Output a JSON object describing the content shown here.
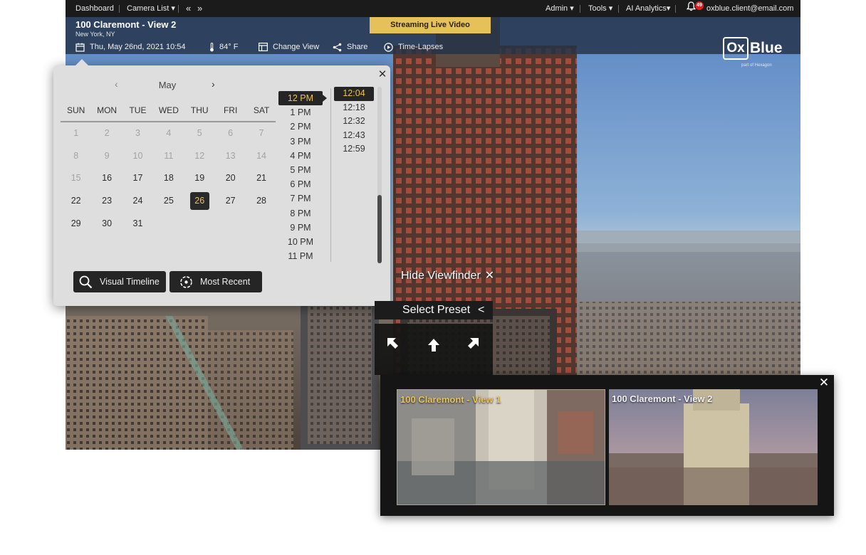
{
  "nav": {
    "dashboard": "Dashboard",
    "camera_list": "Camera List ▾",
    "prev": "«",
    "next": "»",
    "admin": "Admin ▾",
    "tools": "Tools ▾",
    "ai_analytics": "AI Analytics▾",
    "notification_count": "49",
    "user_email": "oxblue.client@email.com"
  },
  "camera": {
    "title": "100 Claremont - View 2",
    "location": "New York, NY",
    "datetime": "Thu, May 26nd, 2021 10:54",
    "temperature": "84° F",
    "change_view": "Change View",
    "share": "Share",
    "time_lapses": "Time-Lapses",
    "live_banner": "Streaming Live Video"
  },
  "brand": {
    "logo_box": "Ox",
    "logo_text": "Blue",
    "tagline": "part of Hexagon",
    "accent_color": "#e8c25a"
  },
  "picker": {
    "month": "May",
    "prev_icon": "‹",
    "next_icon": "›",
    "close_icon": "✕",
    "weekdays": [
      "SUN",
      "MON",
      "TUE",
      "WED",
      "THU",
      "FRI",
      "SAT"
    ],
    "days": [
      {
        "n": "1",
        "state": "disabled"
      },
      {
        "n": "2",
        "state": "disabled"
      },
      {
        "n": "3",
        "state": "disabled"
      },
      {
        "n": "4",
        "state": "disabled"
      },
      {
        "n": "5",
        "state": "disabled"
      },
      {
        "n": "6",
        "state": "disabled"
      },
      {
        "n": "7",
        "state": "disabled"
      },
      {
        "n": "8",
        "state": "disabled"
      },
      {
        "n": "9",
        "state": "disabled"
      },
      {
        "n": "10",
        "state": "disabled"
      },
      {
        "n": "11",
        "state": "disabled"
      },
      {
        "n": "12",
        "state": "disabled"
      },
      {
        "n": "13",
        "state": "disabled"
      },
      {
        "n": "14",
        "state": "disabled"
      },
      {
        "n": "15",
        "state": "disabled"
      },
      {
        "n": "16",
        "state": "enabled"
      },
      {
        "n": "17",
        "state": "enabled"
      },
      {
        "n": "18",
        "state": "enabled"
      },
      {
        "n": "19",
        "state": "enabled"
      },
      {
        "n": "20",
        "state": "enabled"
      },
      {
        "n": "21",
        "state": "enabled"
      },
      {
        "n": "22",
        "state": "enabled"
      },
      {
        "n": "23",
        "state": "enabled"
      },
      {
        "n": "24",
        "state": "enabled"
      },
      {
        "n": "25",
        "state": "enabled"
      },
      {
        "n": "26",
        "state": "selected"
      },
      {
        "n": "27",
        "state": "enabled"
      },
      {
        "n": "28",
        "state": "enabled"
      },
      {
        "n": "29",
        "state": "enabled"
      },
      {
        "n": "30",
        "state": "enabled"
      },
      {
        "n": "31",
        "state": "enabled"
      }
    ],
    "hours": [
      "12 PM",
      "1 PM",
      "2 PM",
      "3 PM",
      "4 PM",
      "5 PM",
      "6 PM",
      "7 PM",
      "8 PM",
      "9 PM",
      "10 PM",
      "11 PM"
    ],
    "selected_hour": "12 PM",
    "minutes": [
      "12:04",
      "12:18",
      "12:32",
      "12:43",
      "12:59"
    ],
    "selected_minute": "12:04",
    "visual_timeline": "Visual Timeline",
    "most_recent": "Most Recent"
  },
  "viewfinder": {
    "hide_label": "Hide Viewfinder",
    "hide_icon": "✕",
    "select_preset": "Select Preset",
    "preset_chevron": "<"
  },
  "switcher": {
    "close_icon": "✕",
    "views": [
      {
        "label": "100 Claremont - View 1",
        "active": true
      },
      {
        "label": "100 Claremont - View 2",
        "active": false
      }
    ]
  }
}
